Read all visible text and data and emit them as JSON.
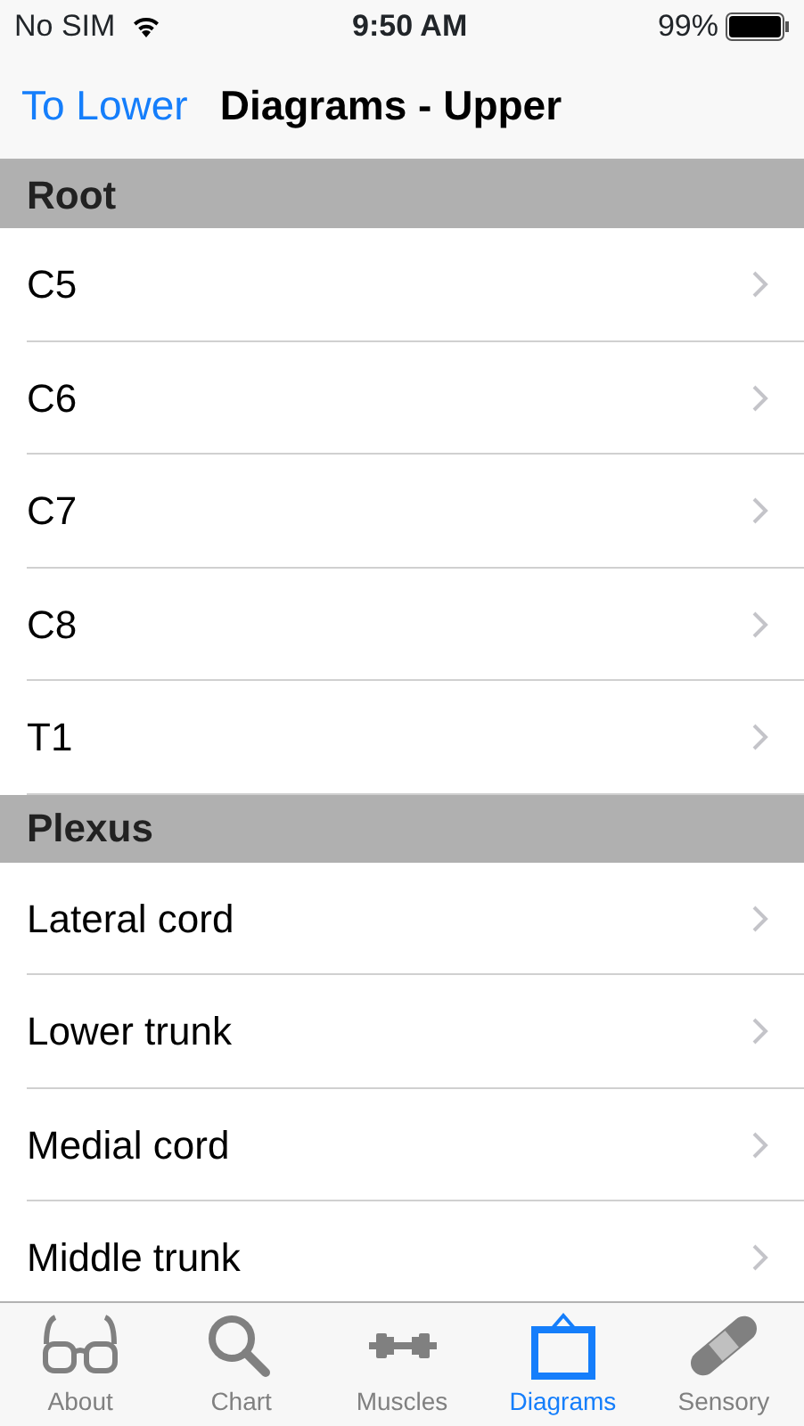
{
  "status_bar": {
    "carrier": "No SIM",
    "time": "9:50 AM",
    "battery": "99%"
  },
  "nav": {
    "back": "To Lower",
    "title": "Diagrams - Upper"
  },
  "sections": [
    {
      "title": "Root",
      "rows": [
        "C5",
        "C6",
        "C7",
        "C8",
        "T1"
      ]
    },
    {
      "title": "Plexus",
      "rows": [
        "Lateral cord",
        "Lower trunk",
        "Medial cord",
        "Middle trunk"
      ]
    }
  ],
  "tabs": [
    {
      "label": "About",
      "kind": "glasses",
      "selected": false
    },
    {
      "label": "Chart",
      "kind": "search",
      "selected": false
    },
    {
      "label": "Muscles",
      "kind": "dumbbell",
      "selected": false
    },
    {
      "label": "Diagrams",
      "kind": "frame",
      "selected": true
    },
    {
      "label": "Sensory",
      "kind": "bandage",
      "selected": false
    }
  ]
}
